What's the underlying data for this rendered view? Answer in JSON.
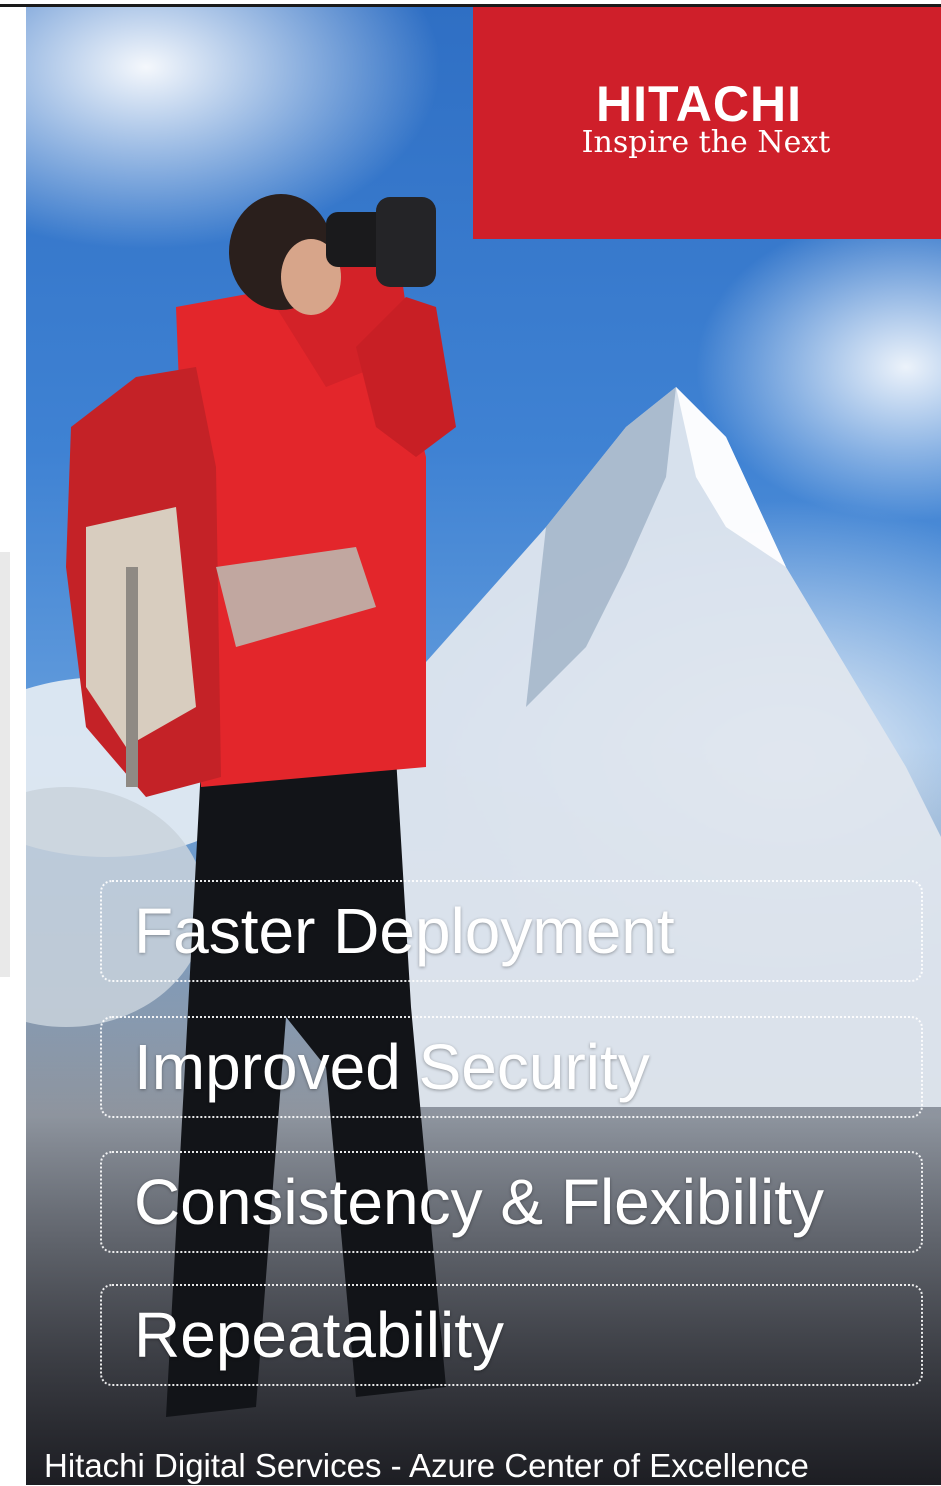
{
  "brand": {
    "logo": "HITACHI",
    "tagline": "Inspire the Next",
    "accent_color": "#cf1f2a"
  },
  "features": [
    {
      "label": "Faster Deployment"
    },
    {
      "label": "Improved Security"
    },
    {
      "label": "Consistency & Flexibility"
    },
    {
      "label": "Repeatability"
    }
  ],
  "footer": {
    "text": "Hitachi Digital Services - Azure Center of Excellence"
  }
}
